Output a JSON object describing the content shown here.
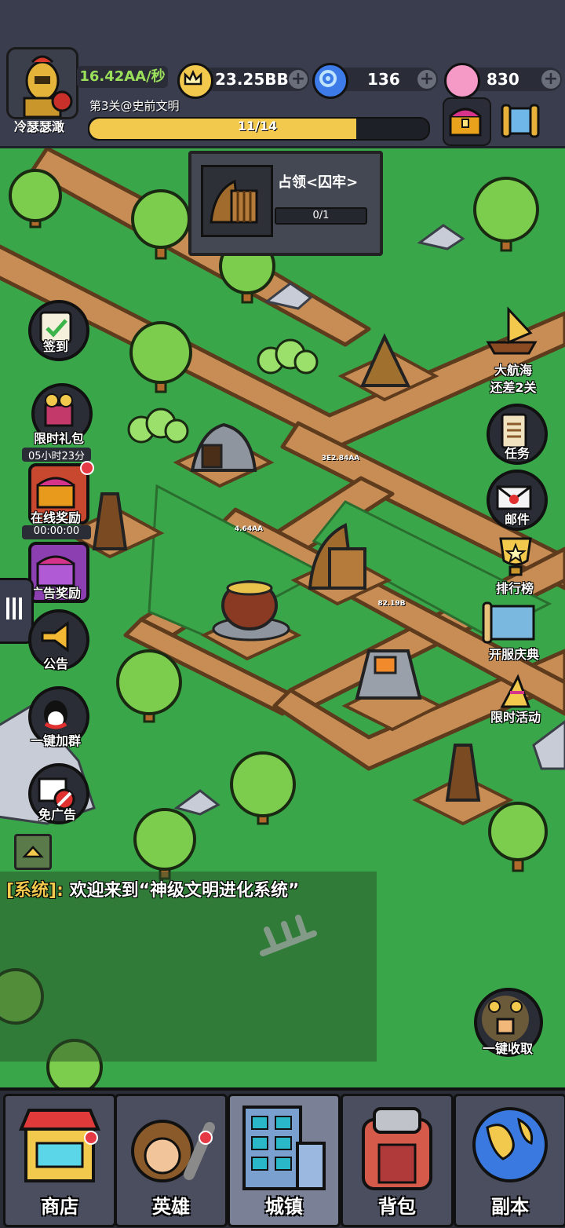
{
  "player": {
    "name": "冷瑟瑟澉",
    "rate": "16.42AA/秒"
  },
  "resources": {
    "gold": "23.25BB",
    "gems": "136",
    "candy": "830"
  },
  "level": {
    "text": "第3关@史前文明",
    "progress_text": "11/14",
    "progress_fraction": 0.786
  },
  "quest": {
    "title": "占领<囚牢>",
    "progress": "0/1"
  },
  "left_buttons": {
    "checkin": "签到",
    "limited_gift": "限时礼包",
    "limited_gift_timer": "05小时23分",
    "online_reward": "在线奖励",
    "online_timer": "00:00:00",
    "ad_reward": "广告奖励",
    "notice": "公告",
    "join_group": "一键加群",
    "no_ads": "免广告"
  },
  "right_buttons": {
    "voyage": "大航海",
    "voyage_sub": "还差2关",
    "tasks": "任务",
    "mail": "邮件",
    "ranking": "排行榜",
    "server_celebration": "开服庆典",
    "limited_event": "限时活动",
    "collect_all": "一键收取"
  },
  "map_labels": {
    "b1": "3E2.84AA",
    "b2": "4.64AA",
    "b3": "82.19B"
  },
  "system": {
    "tag": "[系统]:",
    "message": " 欢迎来到“神级文明进化系统”"
  },
  "nav": {
    "shop": "商店",
    "heroes": "英雄",
    "town": "城镇",
    "bag": "背包",
    "dungeon": "副本"
  },
  "colors": {
    "accent_gold": "#f2c94c",
    "rate_green": "#9be05a",
    "panel_dark": "#3a3d4d"
  }
}
